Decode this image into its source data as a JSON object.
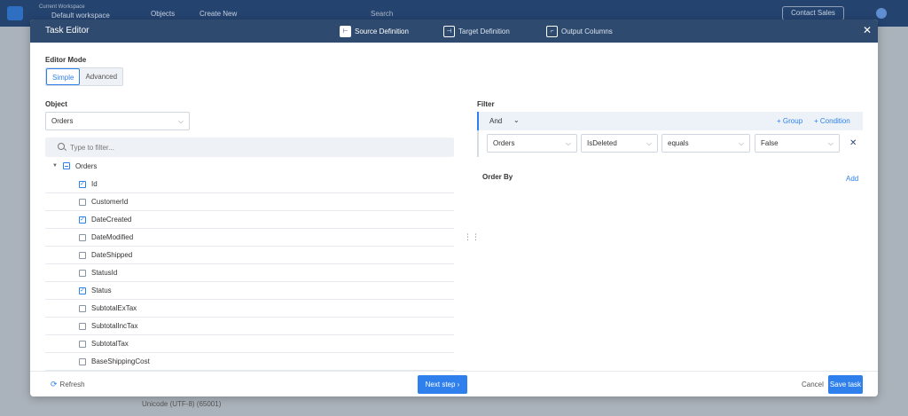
{
  "background": {
    "workspace_label": "Current Workspace",
    "workspace_name": "Default workspace",
    "objects_label": "Objects",
    "create_new_label": "Create New",
    "search_placeholder": "Search",
    "contact_sales_label": "Contact Sales",
    "footer_text": "Unicode (UTF-8) (65001)"
  },
  "modal": {
    "title": "Task Editor",
    "steps": [
      {
        "label": "Source Definition",
        "active": true,
        "icon": "source-icon"
      },
      {
        "label": "Target Definition",
        "active": false,
        "icon": "target-icon"
      },
      {
        "label": "Output Columns",
        "active": false,
        "icon": "columns-icon"
      }
    ],
    "editor_mode": {
      "label": "Editor Mode",
      "options": [
        "Simple",
        "Advanced"
      ],
      "selected": "Simple"
    },
    "object": {
      "label": "Object",
      "value": "Orders",
      "filter_placeholder": "Type to filter...",
      "root": "Orders",
      "fields": [
        {
          "name": "Id",
          "checked": true
        },
        {
          "name": "CustomerId",
          "checked": false
        },
        {
          "name": "DateCreated",
          "checked": true
        },
        {
          "name": "DateModified",
          "checked": false
        },
        {
          "name": "DateShipped",
          "checked": false
        },
        {
          "name": "StatusId",
          "checked": false
        },
        {
          "name": "Status",
          "checked": true
        },
        {
          "name": "SubtotalExTax",
          "checked": false
        },
        {
          "name": "SubtotalIncTax",
          "checked": false
        },
        {
          "name": "SubtotalTax",
          "checked": false
        },
        {
          "name": "BaseShippingCost",
          "checked": false
        }
      ]
    },
    "filter": {
      "label": "Filter",
      "operator": "And",
      "group_label": "Group",
      "condition_label": "Condition",
      "condition": {
        "object": "Orders",
        "field": "IsDeleted",
        "operator": "equals",
        "value": "False"
      }
    },
    "order_by": {
      "label": "Order By",
      "add_label": "Add"
    },
    "footer": {
      "refresh_label": "Refresh",
      "next_label": "Next step",
      "cancel_label": "Cancel",
      "save_label": "Save task"
    }
  },
  "colors": {
    "primary": "#2f80ed",
    "header": "#2e4a6e"
  }
}
